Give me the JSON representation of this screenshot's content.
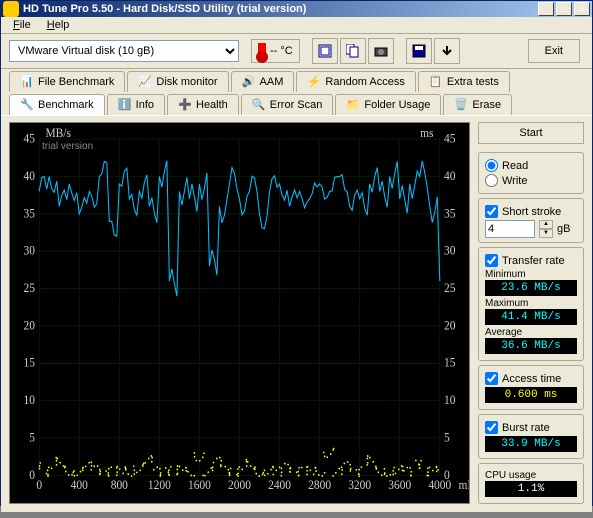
{
  "window": {
    "title": "HD Tune Pro 5.50 - Hard Disk/SSD Utility (trial version)"
  },
  "menu": {
    "file": "File",
    "help": "Help"
  },
  "toolbar": {
    "drive": "VMware  Virtual disk (10 gB)",
    "temp": "-- °C",
    "exit": "Exit"
  },
  "tabs_row1": [
    {
      "label": "File Benchmark",
      "icon": "file-benchmark-icon"
    },
    {
      "label": "Disk monitor",
      "icon": "disk-monitor-icon"
    },
    {
      "label": "AAM",
      "icon": "aam-icon"
    },
    {
      "label": "Random Access",
      "icon": "random-access-icon"
    },
    {
      "label": "Extra tests",
      "icon": "extra-tests-icon"
    }
  ],
  "tabs_row2": [
    {
      "label": "Benchmark",
      "icon": "benchmark-icon"
    },
    {
      "label": "Info",
      "icon": "info-icon"
    },
    {
      "label": "Health",
      "icon": "health-icon"
    },
    {
      "label": "Error Scan",
      "icon": "error-scan-icon"
    },
    {
      "label": "Folder Usage",
      "icon": "folder-usage-icon"
    },
    {
      "label": "Erase",
      "icon": "erase-icon"
    }
  ],
  "chart": {
    "y_label_left": "MB/s",
    "y_label_right": "ms",
    "trial": "trial version"
  },
  "side": {
    "start": "Start",
    "read": "Read",
    "write": "Write",
    "short_stroke": "Short stroke",
    "stroke_value": "4",
    "stroke_unit": "gB",
    "transfer_rate": "Transfer rate",
    "minimum_label": "Minimum",
    "minimum_value": "23.6 MB/s",
    "maximum_label": "Maximum",
    "maximum_value": "41.4 MB/s",
    "average_label": "Average",
    "average_value": "36.6 MB/s",
    "access_time": "Access time",
    "access_value": "0.600 ms",
    "burst_rate": "Burst rate",
    "burst_value": "33.9 MB/s",
    "cpu_label": "CPU usage",
    "cpu_value": "1.1%"
  },
  "chart_data": {
    "type": "line",
    "title": "",
    "xlabel": "mB",
    "ylabel_left": "MB/s",
    "ylabel_right": "ms",
    "xlim": [
      0,
      4000
    ],
    "ylim": [
      0,
      45
    ],
    "x_ticks": [
      0,
      400,
      800,
      1200,
      1600,
      2000,
      2400,
      2800,
      3200,
      3600,
      4000
    ],
    "y_ticks": [
      0,
      5,
      10,
      15,
      20,
      25,
      30,
      35,
      40,
      45
    ],
    "series": [
      {
        "name": "Transfer rate (MB/s)",
        "color": "#00bfff",
        "x": [
          0,
          100,
          200,
          300,
          400,
          500,
          600,
          700,
          800,
          900,
          1000,
          1100,
          1200,
          1300,
          1400,
          1500,
          1600,
          1700,
          1800,
          1900,
          2000,
          2100,
          2200,
          2300,
          2400,
          2500,
          2600,
          2700,
          2800,
          2900,
          3000,
          3100,
          3200,
          3300,
          3400,
          3500,
          3600,
          3700,
          3800,
          3900,
          4000
        ],
        "values": [
          38,
          40,
          36,
          39,
          35,
          38,
          40,
          34,
          39,
          37,
          38,
          36,
          40,
          26,
          38,
          37,
          39,
          28,
          36,
          39,
          37,
          38,
          35,
          38,
          39,
          36,
          38,
          37,
          39,
          38,
          40,
          36,
          37,
          39,
          38,
          40,
          37,
          39,
          40,
          36,
          26
        ]
      },
      {
        "name": "Access time (ms)",
        "color": "#ffff00",
        "x": [
          0,
          100,
          200,
          300,
          400,
          500,
          600,
          700,
          800,
          900,
          1000,
          1100,
          1200,
          1300,
          1400,
          1500,
          1600,
          1700,
          1800,
          1900,
          2000,
          2100,
          2200,
          2300,
          2400,
          2500,
          2600,
          2700,
          2800,
          2900,
          3000,
          3100,
          3200,
          3300,
          3400,
          3500,
          3600,
          3700,
          3800,
          3900,
          4000
        ],
        "values": [
          1.5,
          0.5,
          1.8,
          0.6,
          0.5,
          1.2,
          0.7,
          0.5,
          0.6,
          0.5,
          1.0,
          2.0,
          0.5,
          0.6,
          0.7,
          0.5,
          2.5,
          0.5,
          1.8,
          0.6,
          0.5,
          1.5,
          0.5,
          0.6,
          0.5,
          1.0,
          0.5,
          0.6,
          0.5,
          3.0,
          0.5,
          1.2,
          0.5,
          2.0,
          0.6,
          0.5,
          0.7,
          0.5,
          1.5,
          0.5,
          0.6
        ]
      }
    ]
  }
}
